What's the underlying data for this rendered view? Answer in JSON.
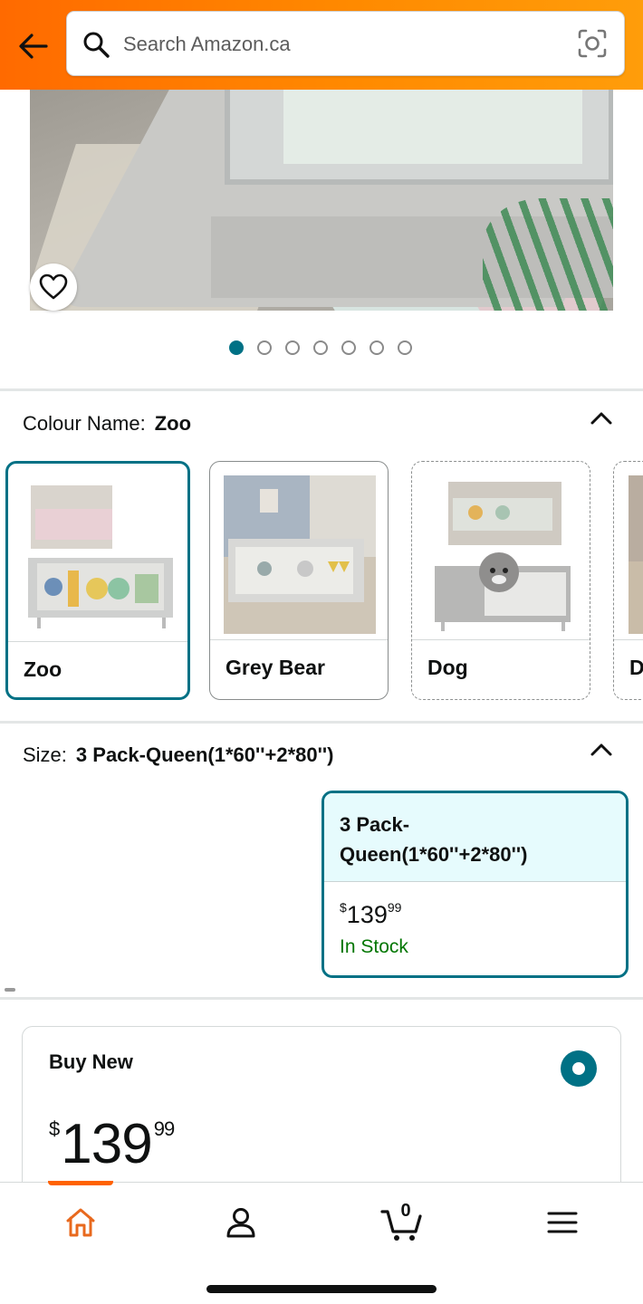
{
  "header": {
    "search_placeholder": "Search Amazon.ca",
    "brand_color": "#ff7a00"
  },
  "product_image": {
    "carousel_count": 7,
    "carousel_active_index": 0
  },
  "colour": {
    "label": "Colour Name:",
    "selected": "Zoo",
    "options": [
      {
        "label": "Zoo"
      },
      {
        "label": "Grey Bear"
      },
      {
        "label": "Dog"
      },
      {
        "label": "D"
      }
    ]
  },
  "size": {
    "label": "Size:",
    "selected": "3 Pack-Queen(1*60''+2*80'')",
    "option": {
      "name_line1": "3 Pack-",
      "name_line2": "Queen(1*60''+2*80'')",
      "price_currency": "$",
      "price_whole": "139",
      "price_fraction": "99",
      "stock": "In Stock"
    }
  },
  "buy_new": {
    "title": "Buy New",
    "price_currency": "$",
    "price_whole": "139",
    "price_fraction": "99"
  },
  "bottom_nav": {
    "cart_count": "0"
  },
  "colors": {
    "accent": "#007185",
    "in_stock": "#007600",
    "nav_active": "#ff6200"
  }
}
